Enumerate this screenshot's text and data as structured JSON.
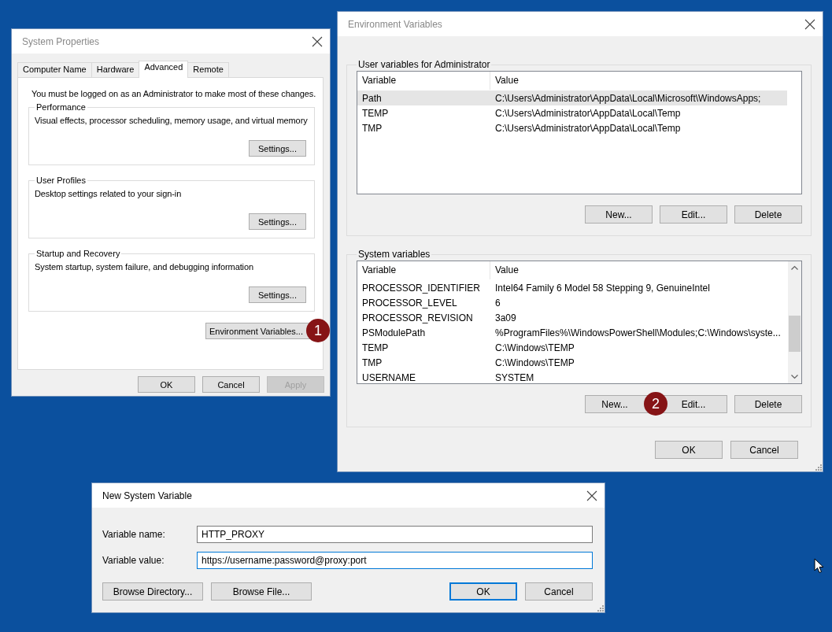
{
  "windows": [
    {
      "kind": "system_properties",
      "title": "System Properties",
      "tabs": [
        {
          "label": "Computer Name",
          "selected": false
        },
        {
          "label": "Hardware",
          "selected": false
        },
        {
          "label": "Advanced",
          "selected": true
        },
        {
          "label": "Remote",
          "selected": false
        }
      ],
      "notice": "You must be logged on as an Administrator to make most of these changes.",
      "groups": [
        {
          "title": "Performance",
          "description": "Visual effects, processor scheduling, memory usage, and virtual memory",
          "button": "Settings..."
        },
        {
          "title": "User Profiles",
          "description": "Desktop settings related to your sign-in",
          "button": "Settings..."
        },
        {
          "title": "Startup and Recovery",
          "description": "System startup, system failure, and debugging information",
          "button": "Settings..."
        }
      ],
      "environment_button": {
        "label": "Environment Variables...",
        "marker": "1"
      },
      "buttons": [
        {
          "label": "OK",
          "disabled": false
        },
        {
          "label": "Cancel",
          "disabled": false
        },
        {
          "label": "Apply",
          "disabled": true
        }
      ]
    },
    {
      "kind": "environment_variables",
      "title": "Environment Variables",
      "sections": [
        {
          "title": "User variables for Administrator",
          "columns": [
            "Variable",
            "Value"
          ],
          "scrollable": false,
          "rows": [
            {
              "variable": "Path",
              "value": "C:\\Users\\Administrator\\AppData\\Local\\Microsoft\\WindowsApps;",
              "selected": true
            },
            {
              "variable": "TEMP",
              "value": "C:\\Users\\Administrator\\AppData\\Local\\Temp",
              "selected": false
            },
            {
              "variable": "TMP",
              "value": "C:\\Users\\Administrator\\AppData\\Local\\Temp",
              "selected": false
            }
          ],
          "buttons": [
            {
              "label": "New..."
            },
            {
              "label": "Edit..."
            },
            {
              "label": "Delete"
            }
          ]
        },
        {
          "title": "System variables",
          "columns": [
            "Variable",
            "Value"
          ],
          "scrollable": true,
          "rows": [
            {
              "variable": "PROCESSOR_IDENTIFIER",
              "value": "Intel64 Family 6 Model 58 Stepping 9, GenuineIntel",
              "selected": false
            },
            {
              "variable": "PROCESSOR_LEVEL",
              "value": "6",
              "selected": false
            },
            {
              "variable": "PROCESSOR_REVISION",
              "value": "3a09",
              "selected": false
            },
            {
              "variable": "PSModulePath",
              "value": "%ProgramFiles%\\WindowsPowerShell\\Modules;C:\\Windows\\syste...",
              "selected": false
            },
            {
              "variable": "TEMP",
              "value": "C:\\Windows\\TEMP",
              "selected": false
            },
            {
              "variable": "TMP",
              "value": "C:\\Windows\\TEMP",
              "selected": false
            },
            {
              "variable": "USERNAME",
              "value": "SYSTEM",
              "selected": false
            }
          ],
          "buttons": [
            {
              "label": "New...",
              "marker": "2"
            },
            {
              "label": "Edit..."
            },
            {
              "label": "Delete"
            }
          ]
        }
      ],
      "buttons": [
        {
          "label": "OK"
        },
        {
          "label": "Cancel"
        }
      ]
    },
    {
      "kind": "new_variable",
      "title": "New System Variable",
      "fields": [
        {
          "label": "Variable name:",
          "value": "HTTP_PROXY",
          "focused": false
        },
        {
          "label": "Variable value:",
          "value": "https://username:password@proxy:port",
          "focused": true
        }
      ],
      "left_buttons": [
        {
          "label": "Browse Directory...",
          "default": false
        },
        {
          "label": "Browse File...",
          "default": false
        }
      ],
      "buttons": [
        {
          "label": "OK",
          "default": true
        },
        {
          "label": "Cancel",
          "default": false
        }
      ]
    }
  ]
}
